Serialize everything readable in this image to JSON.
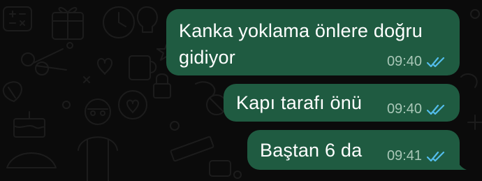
{
  "colors": {
    "background": "#0b0b0b",
    "bubble_outgoing": "#1f5b41",
    "message_text": "#ffffff",
    "timestamp_text": "#a9c7b7",
    "read_receipt": "#53bdeb"
  },
  "messages": [
    {
      "text_line1": "Kanka yoklama önlere doğru",
      "text_line2": "gidiyor",
      "time": "09:40",
      "status_icon": "double-check-read-icon"
    },
    {
      "text": "Kapı tarafı önü",
      "time": "09:40",
      "status_icon": "double-check-read-icon"
    },
    {
      "text": "Baştan 6 da",
      "time": "09:41",
      "status_icon": "double-check-read-icon"
    }
  ]
}
